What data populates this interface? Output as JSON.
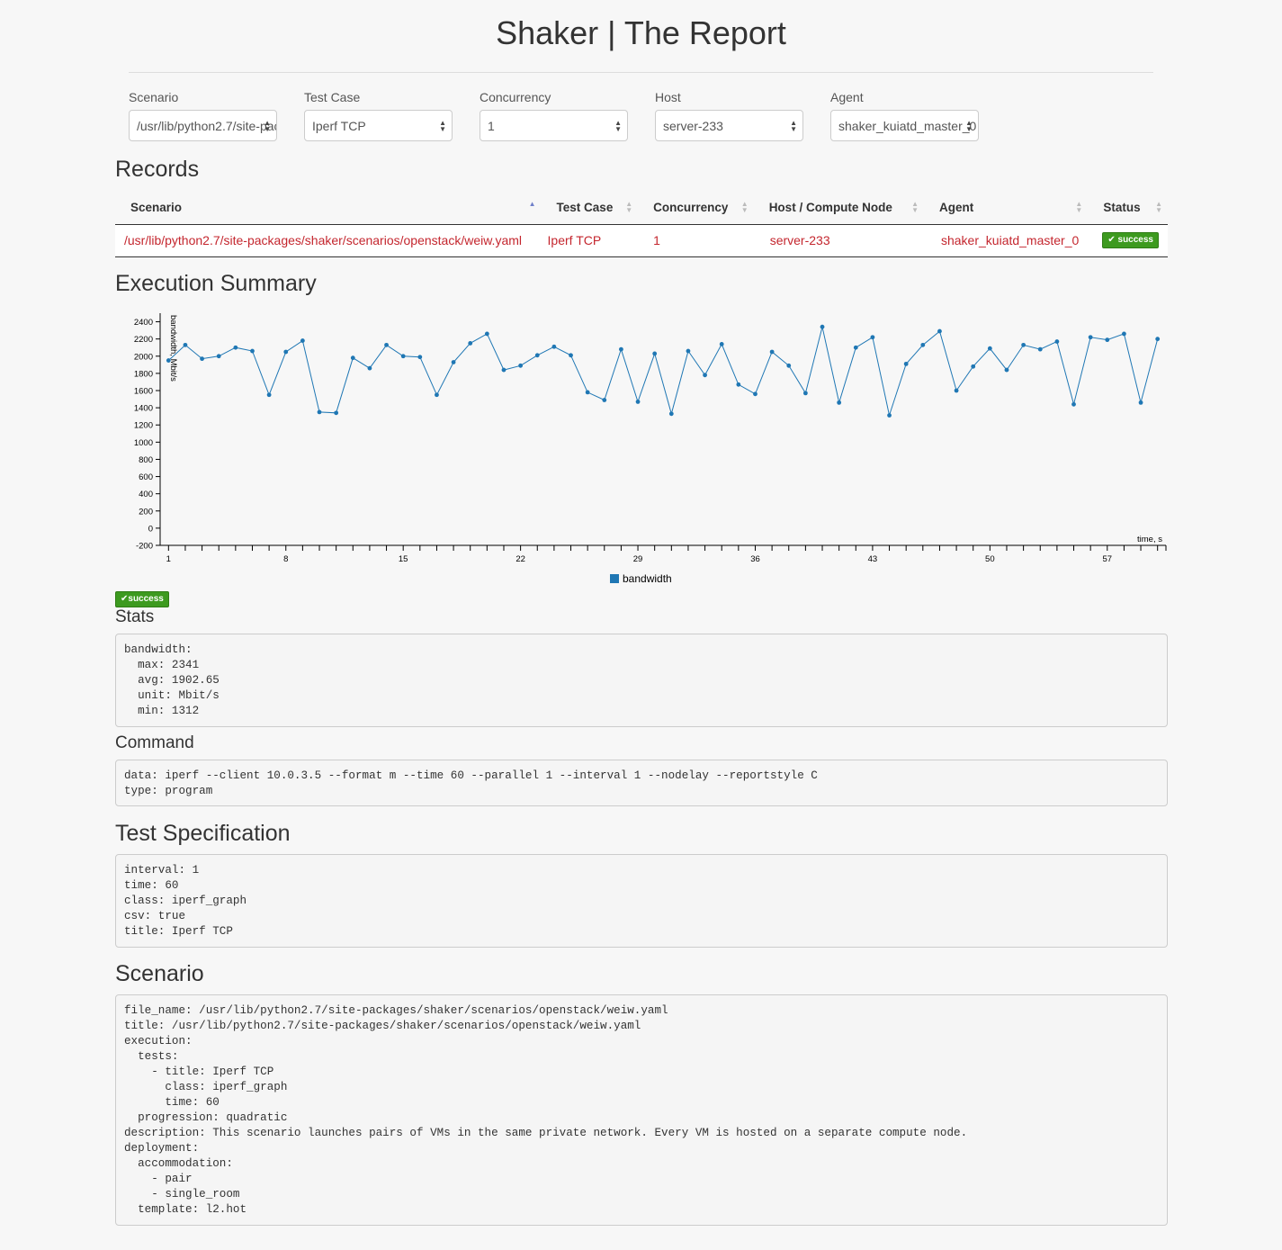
{
  "header": {
    "title": "Shaker | The Report"
  },
  "filters": [
    {
      "label": "Scenario",
      "value": "/usr/lib/python2.7/site-packages/shaker/scenarios/openstack/weiw.yaml"
    },
    {
      "label": "Test Case",
      "value": "Iperf TCP"
    },
    {
      "label": "Concurrency",
      "value": "1"
    },
    {
      "label": "Host",
      "value": "server-233"
    },
    {
      "label": "Agent",
      "value": "shaker_kuiatd_master_0"
    }
  ],
  "records": {
    "title": "Records",
    "columns": [
      "Scenario",
      "Test Case",
      "Concurrency",
      "Host / Compute Node",
      "Agent",
      "Status"
    ],
    "rows": [
      {
        "scenario": "/usr/lib/python2.7/site-packages/shaker/scenarios/openstack/weiw.yaml",
        "test_case": "Iperf TCP",
        "concurrency": "1",
        "host": "server-233",
        "agent": "shaker_kuiatd_master_0",
        "status": "success"
      }
    ]
  },
  "summary": {
    "title": "Execution Summary",
    "status": "success",
    "stats_title": "Stats",
    "stats_text": "bandwidth:\n  max: 2341\n  avg: 1902.65\n  unit: Mbit/s\n  min: 1312",
    "command_title": "Command",
    "command_text": "data: iperf --client 10.0.3.5 --format m --time 60 --parallel 1 --interval 1 --nodelay --reportstyle C\ntype: program"
  },
  "spec": {
    "title": "Test Specification",
    "text": "interval: 1\ntime: 60\nclass: iperf_graph\ncsv: true\ntitle: Iperf TCP"
  },
  "scenario": {
    "title": "Scenario",
    "text": "file_name: /usr/lib/python2.7/site-packages/shaker/scenarios/openstack/weiw.yaml\ntitle: /usr/lib/python2.7/site-packages/shaker/scenarios/openstack/weiw.yaml\nexecution:\n  tests:\n    - title: Iperf TCP\n      class: iperf_graph\n      time: 60\n  progression: quadratic\ndescription: This scenario launches pairs of VMs in the same private network. Every VM is hosted on a separate compute node.\ndeployment:\n  accommodation:\n    - pair\n    - single_room\n  template: l2.hot"
  },
  "chart_data": {
    "type": "line",
    "title": "",
    "xlabel": "time, s",
    "ylabel": "bandwidth, Mbit/s",
    "ylim": [
      -200,
      2500
    ],
    "xlim": [
      0.5,
      60.5
    ],
    "yticks": [
      -200,
      0,
      200,
      400,
      600,
      800,
      1000,
      1200,
      1400,
      1600,
      1800,
      2000,
      2200,
      2400
    ],
    "xticks": [
      1,
      8,
      15,
      22,
      29,
      36,
      43,
      50,
      57
    ],
    "legend": "bottom-center",
    "color": "#1f77b4",
    "series": [
      {
        "name": "bandwidth",
        "x": [
          1,
          2,
          3,
          4,
          5,
          6,
          7,
          8,
          9,
          10,
          11,
          12,
          13,
          14,
          15,
          16,
          17,
          18,
          19,
          20,
          21,
          22,
          23,
          24,
          25,
          26,
          27,
          28,
          29,
          30,
          31,
          32,
          33,
          34,
          35,
          36,
          37,
          38,
          39,
          40,
          41,
          42,
          43,
          44,
          45,
          46,
          47,
          48,
          49,
          50,
          51,
          52,
          53,
          54,
          55,
          56,
          57,
          58,
          59,
          60
        ],
        "values": [
          1950,
          2130,
          1970,
          2000,
          2100,
          2060,
          1550,
          2050,
          2180,
          1350,
          1340,
          1980,
          1860,
          2130,
          2000,
          1990,
          1550,
          1930,
          2150,
          2260,
          1840,
          1890,
          2010,
          2110,
          2010,
          1580,
          1490,
          2080,
          1470,
          2030,
          1330,
          2060,
          1780,
          2140,
          1670,
          1560,
          2050,
          1890,
          1570,
          2341,
          1460,
          2100,
          2220,
          1312,
          1910,
          2130,
          2290,
          1600,
          1880,
          2090,
          1840,
          2130,
          2080,
          2170,
          1440,
          2220,
          2190,
          2260,
          1460,
          2200
        ]
      }
    ]
  }
}
